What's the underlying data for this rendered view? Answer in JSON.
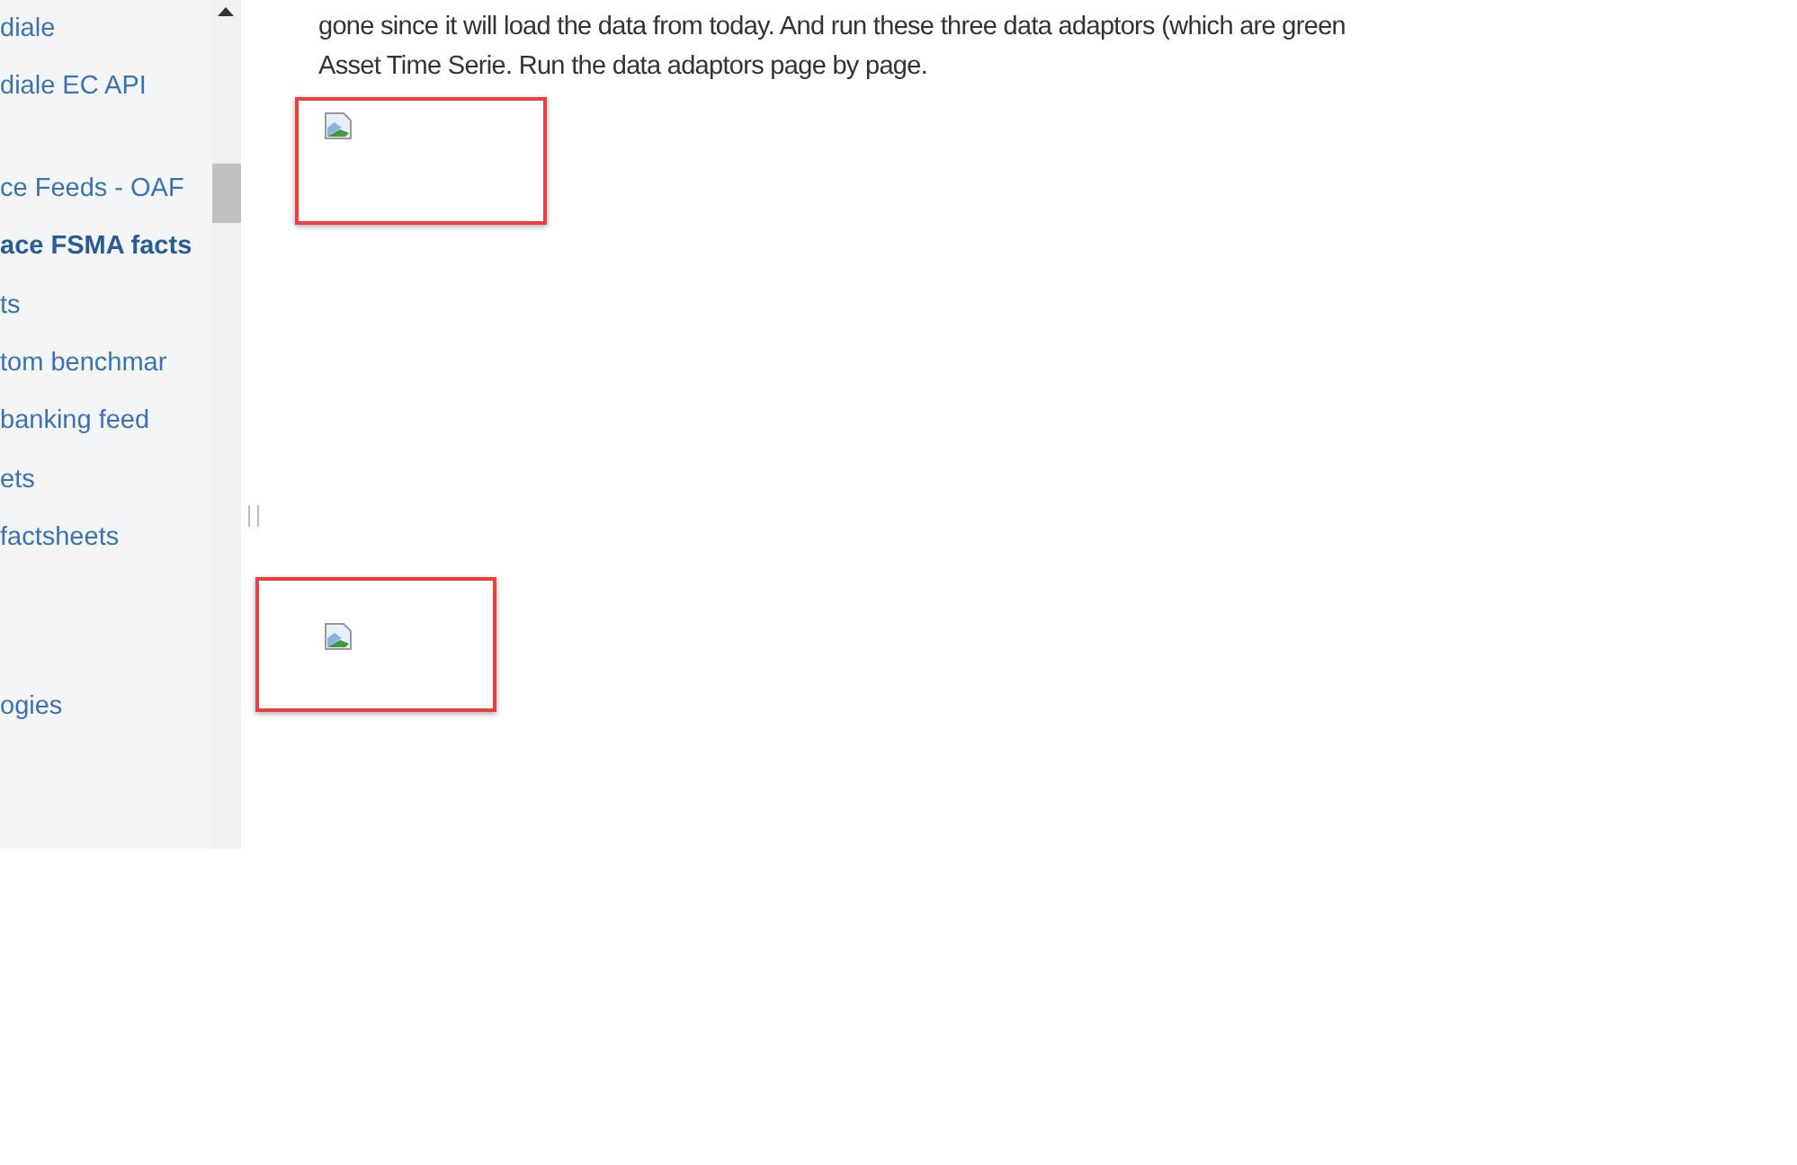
{
  "sidebar": {
    "items": [
      {
        "label": "diale",
        "selected": false
      },
      {
        "label": "diale EC API",
        "selected": false
      },
      {
        "label": "ce Feeds - OAF",
        "selected": false
      },
      {
        "label": "ace FSMA facts",
        "selected": true
      },
      {
        "label": "ts",
        "selected": false
      },
      {
        "label": "tom benchmar",
        "selected": false
      },
      {
        "label": "banking feed",
        "selected": false
      },
      {
        "label": "ets",
        "selected": false
      },
      {
        "label": "factsheets",
        "selected": false
      },
      {
        "label": "ogies",
        "selected": false
      }
    ]
  },
  "content": {
    "paragraph_lines": [
      "gone since it will load the data from today. And run these three data adaptors (which are green",
      "Asset Time Serie. Run the data adaptors page by page."
    ]
  }
}
